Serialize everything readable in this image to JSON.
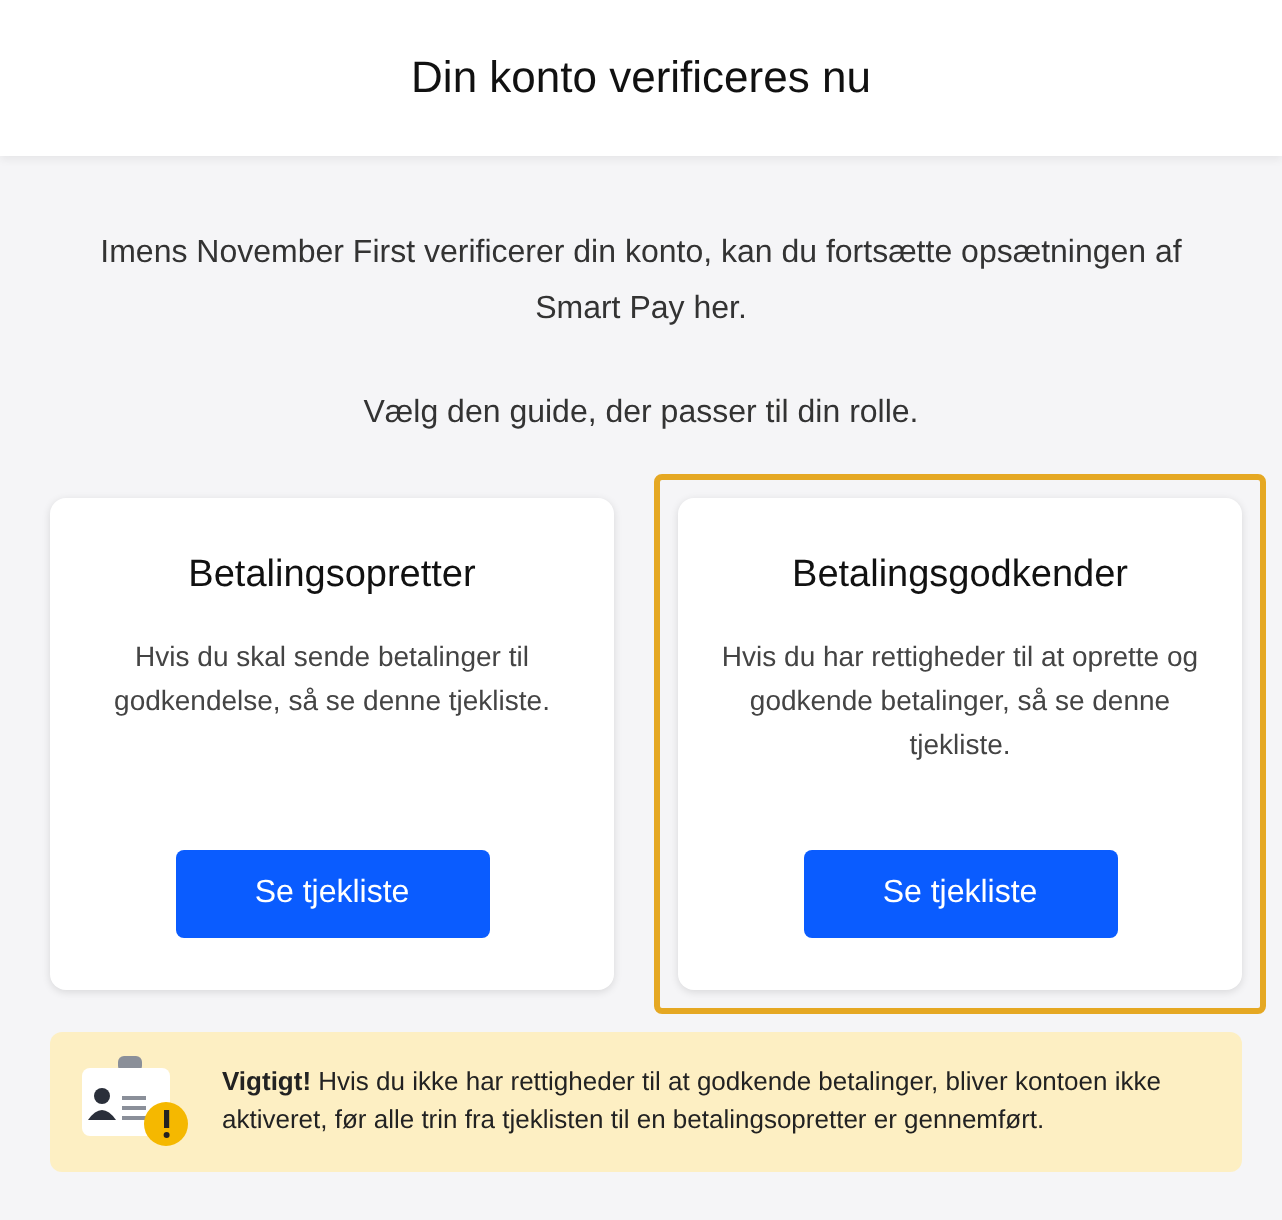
{
  "header": {
    "title": "Din konto verificeres nu"
  },
  "intro": "Imens November First verificerer din konto, kan du fortsætte opsætningen af Smart Pay her.",
  "prompt": "Vælg den guide, der passer til din rolle.",
  "cards": [
    {
      "title": "Betalingsopretter",
      "text": "Hvis du skal sende betalinger til godkendelse, så se denne tjekliste.",
      "button": "Se tjekliste",
      "highlighted": false
    },
    {
      "title": "Betalingsgodkender",
      "text": "Hvis du har rettigheder til at oprette og godkende betalinger, så se denne tjekliste.",
      "button": "Se tjekliste",
      "highlighted": true
    }
  ],
  "notice": {
    "text": "**Vigtigt!** Hvis du ikke har rettigheder til at godkende betalinger, bliver kontoen ikke aktiveret, før alle trin fra tjeklisten til en betalingsopretter er gennemført."
  }
}
